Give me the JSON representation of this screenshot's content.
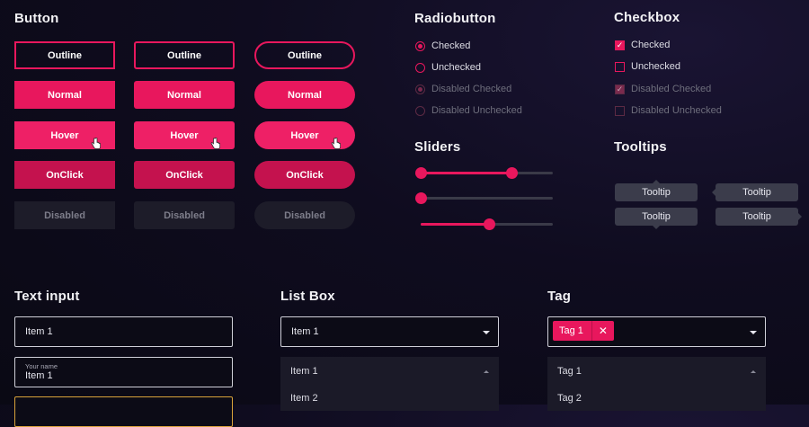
{
  "button": {
    "title": "Button",
    "states": [
      "Outline",
      "Normal",
      "Hover",
      "OnClick",
      "Disabled"
    ]
  },
  "radio": {
    "title": "Radiobutton",
    "items": [
      "Checked",
      "Unchecked",
      "Disabled Checked",
      "Disabled Unchecked"
    ]
  },
  "checkbox": {
    "title": "Checkbox",
    "items": [
      "Checked",
      "Unchecked",
      "Disabled Checked",
      "Disabled Unchecked"
    ]
  },
  "sliders": {
    "title": "Sliders",
    "items": [
      {
        "low": 0.0,
        "high": 0.69
      },
      {
        "value": 0.0
      },
      {
        "value": 0.52
      }
    ]
  },
  "tooltips": {
    "title": "Tooltips",
    "items": [
      "Tooltip",
      "Tooltip",
      "Tooltip",
      "Tooltip"
    ]
  },
  "text_input": {
    "title": "Text input",
    "field1_value": "Item 1",
    "field2_label": "Your name",
    "field2_value": "Item 1"
  },
  "list_box": {
    "title": "List Box",
    "selected": "Item 1",
    "options": [
      "Item 1",
      "Item 2"
    ]
  },
  "tag": {
    "title": "Tag",
    "chip_label": "Tag 1",
    "options": [
      "Tag 1",
      "Tag 2"
    ]
  },
  "colors": {
    "accent": "#e8175d",
    "disabled_bg": "#1d1c29",
    "tooltip_bg": "#3b3c4b"
  },
  "icons": {
    "cursor": "hand-pointer-icon",
    "chevron": "chevron-down-icon",
    "close": "close-icon"
  }
}
